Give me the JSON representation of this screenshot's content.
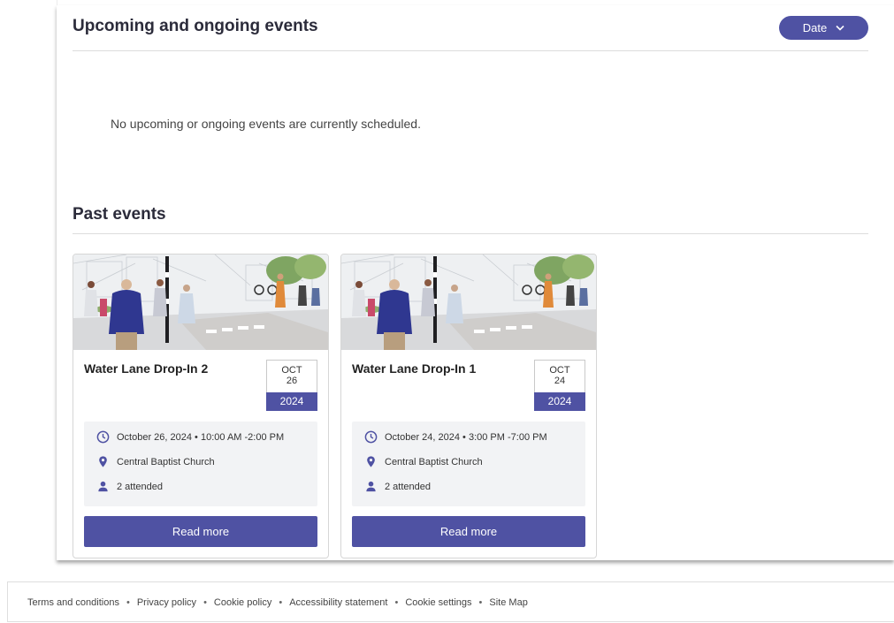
{
  "upcoming": {
    "title": "Upcoming and ongoing events",
    "sort_label": "Date",
    "empty_message": "No upcoming or ongoing events are currently scheduled."
  },
  "past": {
    "title": "Past events",
    "events": [
      {
        "title": "Water Lane Drop-In 2",
        "month": "OCT",
        "day": "26",
        "year": "2024",
        "datetime": "October 26, 2024 • 10:00 AM -2:00 PM",
        "location": "Central Baptist Church",
        "attendance": "2 attended",
        "button": "Read more"
      },
      {
        "title": "Water Lane Drop-In 1",
        "month": "OCT",
        "day": "24",
        "year": "2024",
        "datetime": "October 24, 2024 • 3:00 PM -7:00 PM",
        "location": "Central Baptist Church",
        "attendance": "2 attended",
        "button": "Read more"
      }
    ]
  },
  "footer": {
    "links": [
      "Terms and conditions",
      "Privacy policy",
      "Cookie policy",
      "Accessibility statement",
      "Cookie settings",
      "Site Map"
    ],
    "separator": "•"
  },
  "icons": {
    "sort": "chevron-down-icon",
    "time": "clock-icon",
    "location": "map-pin-icon",
    "attendance": "person-icon"
  },
  "colors": {
    "accent": "#4f52a3",
    "info_bg": "#f2f3f5"
  }
}
